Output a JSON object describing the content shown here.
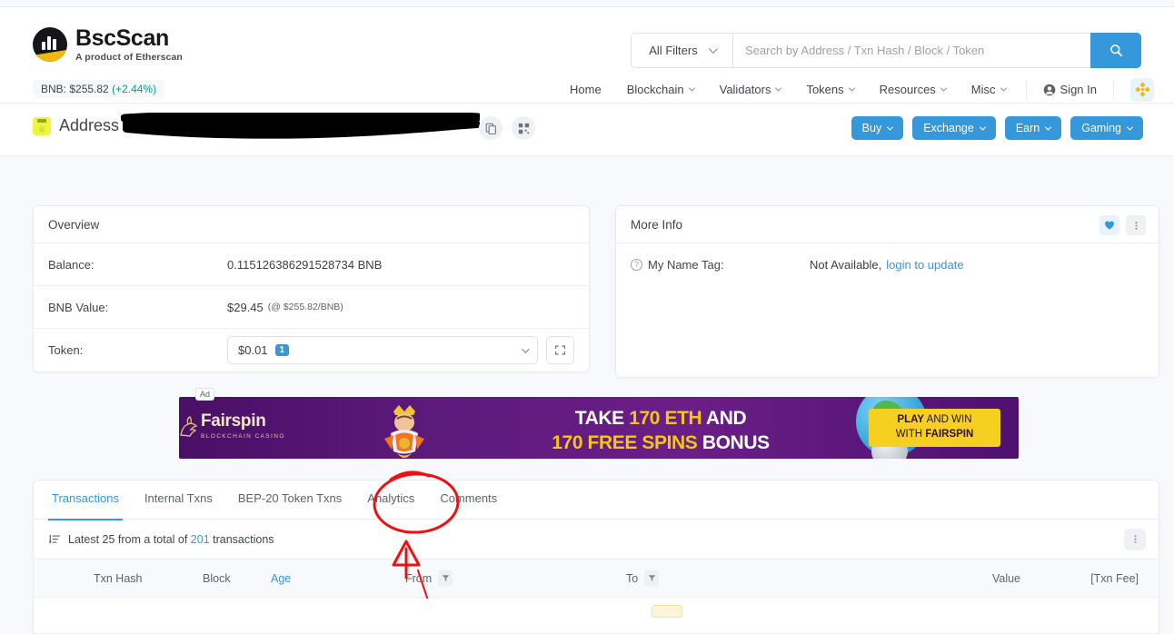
{
  "site": {
    "brand_name": "BscScan",
    "brand_tagline": "A product of Etherscan",
    "price_label": "BNB: $255.82",
    "price_change": "(+2.44%)",
    "accent_color": "#3498db",
    "brand_yellow": "#f0b90b",
    "change_color": "#00a186"
  },
  "search": {
    "filter_label": "All Filters",
    "placeholder": "Search by Address / Txn Hash / Block / Token",
    "value": "",
    "button_icon": "search-icon"
  },
  "nav": {
    "items": [
      {
        "label": "Home",
        "caret": false
      },
      {
        "label": "Blockchain",
        "caret": true
      },
      {
        "label": "Validators",
        "caret": true
      },
      {
        "label": "Tokens",
        "caret": true
      },
      {
        "label": "Resources",
        "caret": true
      },
      {
        "label": "Misc",
        "caret": true
      }
    ],
    "sign_in": "Sign In",
    "chain_icon": "binance-icon"
  },
  "address_bar": {
    "title": "Address",
    "address_redacted": true,
    "copy_icon": "copy-icon",
    "qr_icon": "qrcode-icon",
    "actions": [
      {
        "label": "Buy"
      },
      {
        "label": "Exchange"
      },
      {
        "label": "Earn"
      },
      {
        "label": "Gaming"
      }
    ]
  },
  "overview": {
    "title": "Overview",
    "rows": [
      {
        "label": "Balance:",
        "value": "0.115126386291528734 BNB"
      },
      {
        "label": "BNB Value:",
        "value": "$29.45",
        "sub": "(@ $255.82/BNB)"
      }
    ],
    "token_label": "Token:",
    "token_value": "$0.01",
    "token_count": "1",
    "expand_icon": "expand-icon"
  },
  "more_info": {
    "title": "More Info",
    "heart_icon": "heart-icon",
    "dots_icon": "more-vertical-icon",
    "name_tag_label": "My Name Tag:",
    "name_tag_value": "Not Available,",
    "name_tag_link": "login to update"
  },
  "ad": {
    "label": "Ad",
    "brand": "Fairspin",
    "brand_sub": "BLOCKCHAIN CASINO",
    "line1_pre": "TAKE ",
    "line1_hl": "170 ETH",
    "line1_post": " AND",
    "line2_hl": "170 FREE SPINS",
    "line2_post": " BONUS",
    "cta_line1_b": "PLAY",
    "cta_line1": " AND WIN",
    "cta_line2": "WITH ",
    "cta_line2_b": "FAIRSPIN"
  },
  "tabs": [
    {
      "label": "Transactions",
      "active": true
    },
    {
      "label": "Internal Txns",
      "active": false
    },
    {
      "label": "BEP-20 Token Txns",
      "active": false
    },
    {
      "label": "Analytics",
      "active": false,
      "annotated": true
    },
    {
      "label": "Comments",
      "active": false
    }
  ],
  "tx_summary": {
    "prefix": "Latest 25 from a total of ",
    "count": "201",
    "suffix": " transactions",
    "sort_icon": "sort-descending-icon",
    "menu_icon": "more-vertical-icon"
  },
  "table": {
    "columns": [
      {
        "label": "Txn Hash",
        "filter": false,
        "blue": false
      },
      {
        "label": "Block",
        "filter": false,
        "blue": false
      },
      {
        "label": "Age",
        "filter": false,
        "blue": true
      },
      {
        "label": "From",
        "filter": true,
        "blue": false
      },
      {
        "label": "To",
        "filter": true,
        "blue": false
      },
      {
        "label": "Value",
        "filter": false,
        "blue": false
      },
      {
        "label": "[Txn Fee]",
        "filter": false,
        "blue": false
      }
    ],
    "rows": []
  },
  "annotation": {
    "color": "#ee1111",
    "circle_target": "Analytics",
    "shapes": [
      "ellipse",
      "up-arrow"
    ]
  }
}
